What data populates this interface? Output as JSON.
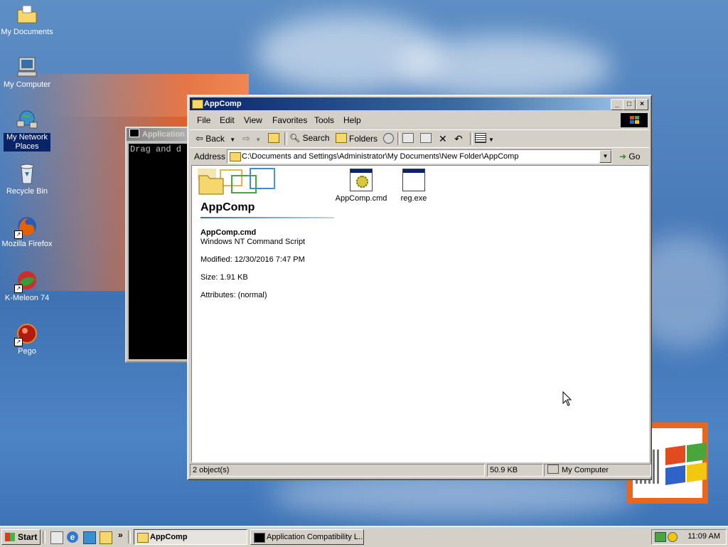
{
  "desktop": {
    "icons": [
      {
        "label": "My Documents"
      },
      {
        "label": "My Computer"
      },
      {
        "label": "My Network Places"
      },
      {
        "label": "Recycle Bin"
      },
      {
        "label": "Mozilla Firefox"
      },
      {
        "label": "K-Meleon 74"
      },
      {
        "label": "Pego"
      }
    ]
  },
  "console": {
    "title": "Application Compatibility L...",
    "text": "Drag and d"
  },
  "explorer": {
    "title": "AppComp",
    "menu": [
      "File",
      "Edit",
      "View",
      "Favorites",
      "Tools",
      "Help"
    ],
    "toolbar": {
      "back": "Back",
      "search": "Search",
      "folders": "Folders"
    },
    "address": {
      "label": "Address",
      "value": "C:\\Documents and Settings\\Administrator\\My Documents\\New Folder\\AppComp",
      "go": "Go"
    },
    "banner_title": "AppComp",
    "details": {
      "name": "AppComp.cmd",
      "type": "Windows NT Command Script",
      "modified": "Modified: 12/30/2016 7:47 PM",
      "size": "Size: 1.91 KB",
      "attributes": "Attributes: (normal)"
    },
    "files": [
      {
        "name": "AppComp.cmd"
      },
      {
        "name": "reg.exe"
      }
    ],
    "status": {
      "objects": "2 object(s)",
      "size": "50.9 KB",
      "zone": "My Computer"
    }
  },
  "taskbar": {
    "start": "Start",
    "tasks": [
      {
        "label": "AppComp"
      },
      {
        "label": "Application Compatibility L..."
      }
    ],
    "clock": "11:09 AM",
    "chevron": "»"
  }
}
